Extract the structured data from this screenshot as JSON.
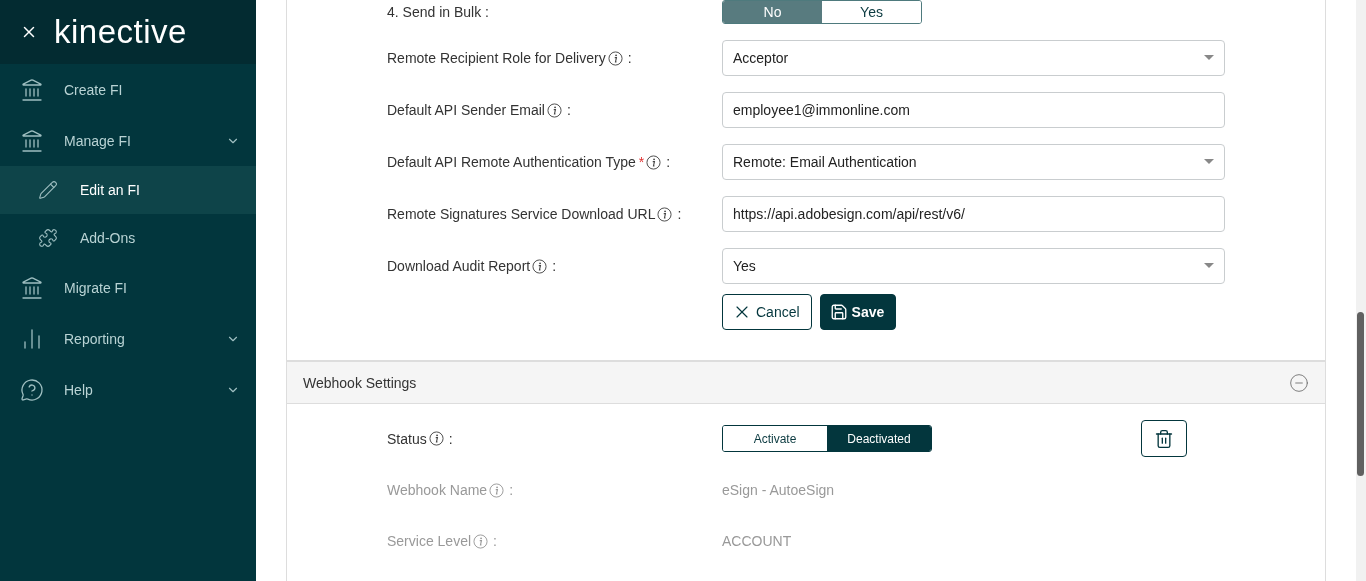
{
  "sidebar": {
    "logo": "kinective",
    "items": [
      {
        "label": "Create FI",
        "expandable": false,
        "selected": false
      },
      {
        "label": "Manage FI",
        "expandable": true,
        "selected": false,
        "children": [
          {
            "label": "Edit an FI",
            "selected": true
          },
          {
            "label": "Add-Ons",
            "selected": false
          }
        ]
      },
      {
        "label": "Migrate FI",
        "expandable": false,
        "selected": false
      },
      {
        "label": "Reporting",
        "expandable": true,
        "selected": false
      },
      {
        "label": "Help",
        "expandable": true,
        "selected": false
      }
    ]
  },
  "form": {
    "fields": [
      {
        "kind": "toggle",
        "label": "4. Send in Bulk :",
        "options": [
          {
            "label": "No",
            "selected": true
          },
          {
            "label": "Yes",
            "selected": false
          }
        ]
      },
      {
        "kind": "select",
        "label": "Remote Recipient Role for Delivery",
        "info": true,
        "colon": ":",
        "value": "Acceptor"
      },
      {
        "kind": "text",
        "label": "Default API Sender Email",
        "info": true,
        "colon": ":",
        "value": "employee1@immonline.com"
      },
      {
        "kind": "select",
        "label": "Default API Remote Authentication Type",
        "required_mark": "*",
        "info": true,
        "colon": ":",
        "value": "Remote: Email Authentication"
      },
      {
        "kind": "text",
        "label": "Remote Signatures Service Download URL",
        "info": true,
        "colon": ":",
        "value": "https://api.adobesign.com/api/rest/v6/"
      },
      {
        "kind": "select",
        "label": "Download Audit Report",
        "info": true,
        "colon": ":",
        "value": "Yes"
      }
    ],
    "buttons": [
      {
        "kind": "cancel",
        "label": "Cancel"
      },
      {
        "kind": "save",
        "label": "Save"
      }
    ]
  },
  "webhook_settings": {
    "title": "Webhook Settings",
    "expanded": true,
    "fields": [
      {
        "kind": "segmented",
        "label": "Status",
        "info": true,
        "colon": ":",
        "options": [
          {
            "label": "Activate",
            "selected": false
          },
          {
            "label": "Deactivated",
            "selected": true
          }
        ]
      },
      {
        "kind": "readonly",
        "label": "Webhook Name",
        "info": true,
        "colon": ":",
        "disabled": true,
        "value": "eSign - AutoeSign"
      },
      {
        "kind": "readonly",
        "label": "Service Level",
        "info": true,
        "colon": ":",
        "disabled": true,
        "value": "ACCOUNT"
      }
    ]
  }
}
